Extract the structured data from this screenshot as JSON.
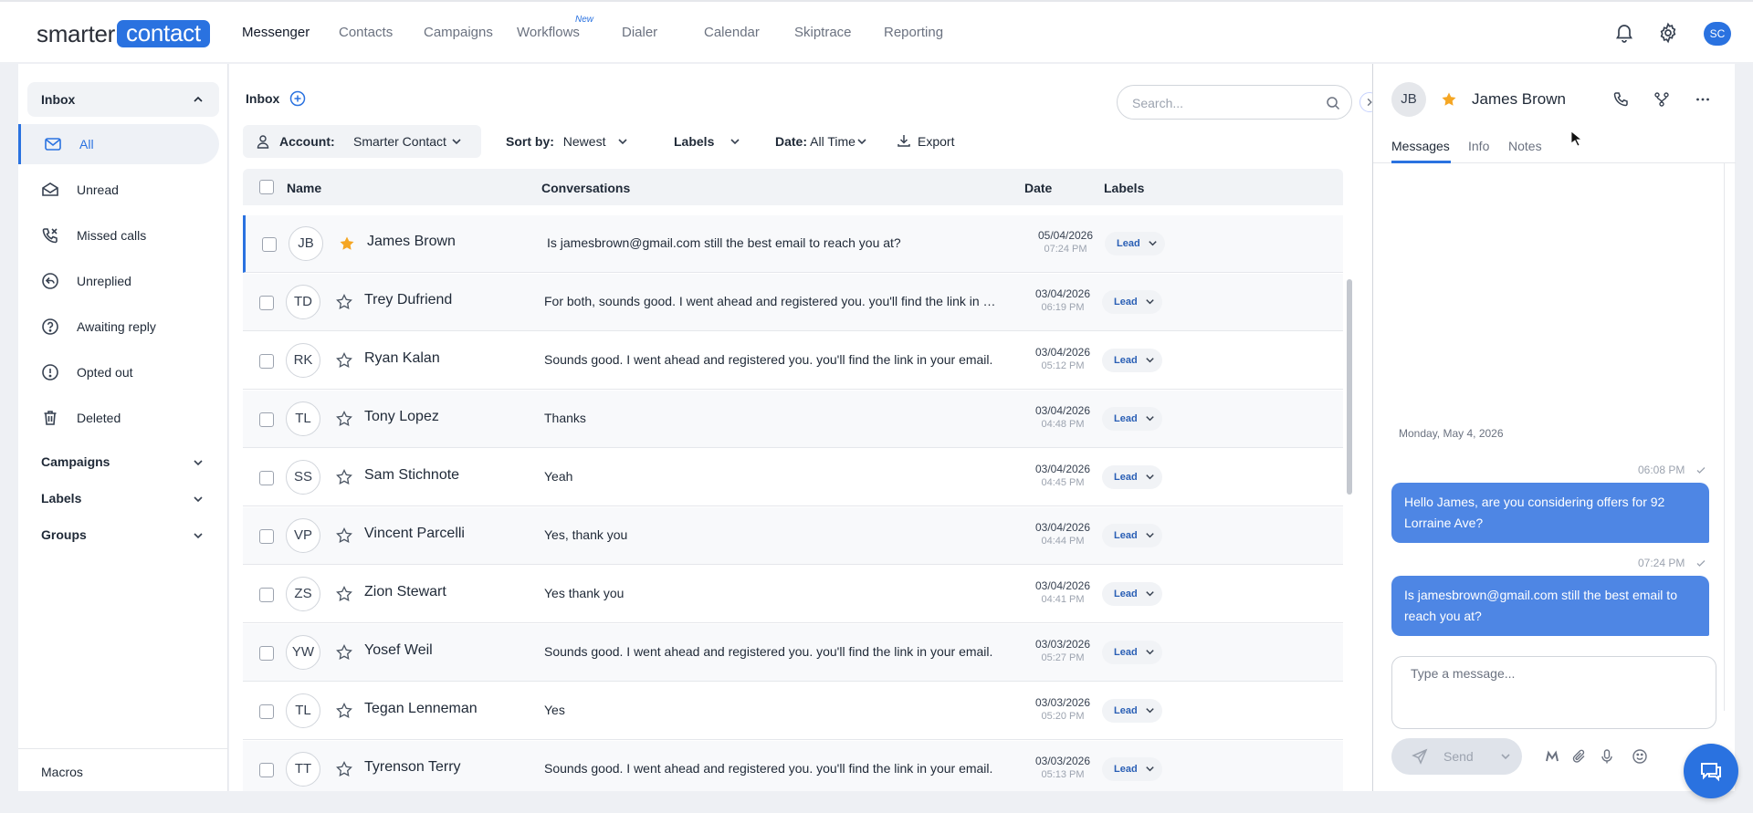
{
  "brand": {
    "word1": "smarter",
    "word2": "contact"
  },
  "nav": [
    {
      "label": "Messenger",
      "active": true
    },
    {
      "label": "Contacts"
    },
    {
      "label": "Campaigns"
    },
    {
      "label": "Workflows",
      "badge": "New"
    },
    {
      "label": "Dialer"
    },
    {
      "label": "Calendar"
    },
    {
      "label": "Skiptrace"
    },
    {
      "label": "Reporting"
    }
  ],
  "user_initials": "SC",
  "sidebar": {
    "inbox_label": "Inbox",
    "items": [
      {
        "label": "All",
        "icon": "mail-icon",
        "active": true
      },
      {
        "label": "Unread",
        "icon": "envelope-open-icon"
      },
      {
        "label": "Missed calls",
        "icon": "missed-call-icon"
      },
      {
        "label": "Unreplied",
        "icon": "reply-icon"
      },
      {
        "label": "Awaiting reply",
        "icon": "question-icon"
      },
      {
        "label": "Opted out",
        "icon": "alert-icon"
      },
      {
        "label": "Deleted",
        "icon": "trash-icon"
      }
    ],
    "groups": [
      "Campaigns",
      "Labels",
      "Groups"
    ],
    "macros": "Macros"
  },
  "main": {
    "title": "Inbox",
    "search_placeholder": "Search...",
    "filters": {
      "account_key": "Account:",
      "account_value": "Smarter Contact",
      "sort_key": "Sort by:",
      "sort_value": "Newest",
      "labels": "Labels",
      "date_key": "Date:",
      "date_value": "All Time",
      "export": "Export"
    },
    "columns": {
      "name": "Name",
      "conversations": "Conversations",
      "date": "Date",
      "labels": "Labels"
    },
    "rows": [
      {
        "initials": "JB",
        "name": "James Brown",
        "starred": true,
        "message": "Is jamesbrown@gmail.com still the best email to reach you at?",
        "date": "05/04/2026",
        "time": "07:24 PM",
        "label": "Lead"
      },
      {
        "initials": "TD",
        "name": "Trey Dufriend",
        "starred": false,
        "message": "For both, sounds good. I went ahead and registered you. you'll find the link in your email.",
        "date": "03/04/2026",
        "time": "06:19 PM",
        "label": "Lead"
      },
      {
        "initials": "RK",
        "name": "Ryan Kalan",
        "starred": false,
        "message": "Sounds good. I went ahead and registered you. you'll find the link in your email.",
        "date": "03/04/2026",
        "time": "05:12 PM",
        "label": "Lead"
      },
      {
        "initials": "TL",
        "name": "Tony Lopez",
        "starred": false,
        "message": "Thanks",
        "date": "03/04/2026",
        "time": "04:48 PM",
        "label": "Lead"
      },
      {
        "initials": "SS",
        "name": "Sam Stichnote",
        "starred": false,
        "message": "Yeah",
        "date": "03/04/2026",
        "time": "04:45 PM",
        "label": "Lead"
      },
      {
        "initials": "VP",
        "name": "Vincent Parcelli",
        "starred": false,
        "message": "Yes, thank you",
        "date": "03/04/2026",
        "time": "04:44 PM",
        "label": "Lead"
      },
      {
        "initials": "ZS",
        "name": "Zion Stewart",
        "starred": false,
        "message": "Yes thank you",
        "date": "03/04/2026",
        "time": "04:41 PM",
        "label": "Lead"
      },
      {
        "initials": "YW",
        "name": "Yosef Weil",
        "starred": false,
        "message": "Sounds good. I went ahead and registered you. you'll find the link in your email.",
        "date": "03/03/2026",
        "time": "05:27 PM",
        "label": "Lead"
      },
      {
        "initials": "TL",
        "name": "Tegan Lenneman",
        "starred": false,
        "message": "Yes",
        "date": "03/03/2026",
        "time": "05:20 PM",
        "label": "Lead"
      },
      {
        "initials": "TT",
        "name": "Tyrenson Terry",
        "starred": false,
        "message": "Sounds good. I went ahead and registered you. you'll find the link in your email.",
        "date": "03/03/2026",
        "time": "05:13 PM",
        "label": "Lead"
      }
    ]
  },
  "panel": {
    "initials": "JB",
    "name": "James Brown",
    "tabs": [
      "Messages",
      "Info",
      "Notes"
    ],
    "day": "Monday, May 4, 2026",
    "messages": [
      {
        "time": "06:08 PM",
        "text": "Hello James, are you considering offers for 92 Lorraine Ave?"
      },
      {
        "time": "07:24 PM",
        "text": "Is jamesbrown@gmail.com still the best email to reach you at?"
      }
    ],
    "compose_placeholder": "Type a message...",
    "send_label": "Send"
  },
  "colors": {
    "accent": "#2a72e0",
    "bubble": "#4e86e4",
    "star": "#f5a623"
  }
}
